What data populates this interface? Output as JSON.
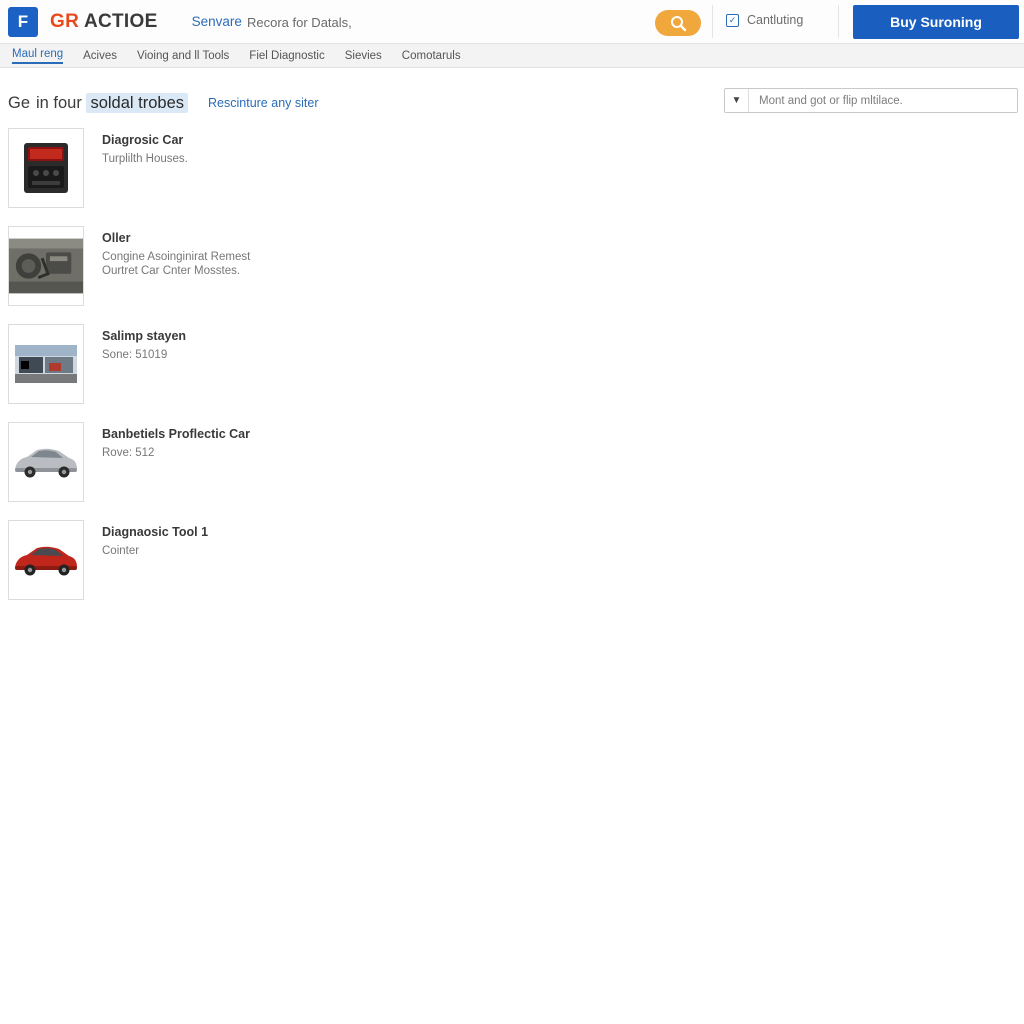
{
  "topbar": {
    "logo_letter": "F",
    "brand_text_1": "GR",
    "brand_text_2": "ACTIOE",
    "nav_primary": "Senvare",
    "search_value": "Recora for Datals,",
    "search_icon": "search-icon",
    "cart_label": "Cantluting",
    "cart_icon": "cart-checkbox-icon",
    "buy_button": "Buy Suroning"
  },
  "subnav": {
    "items": [
      {
        "label": "Maul reng",
        "active": true
      },
      {
        "label": "Acives",
        "active": false
      },
      {
        "label": "Vioing and ll Tools",
        "active": false
      },
      {
        "label": "Fiel Diagnostic",
        "active": false
      },
      {
        "label": "Sievies",
        "active": false
      },
      {
        "label": "Comotaruls",
        "active": false
      }
    ]
  },
  "results": {
    "title_prefix": "Ge",
    "title_mid": "in four",
    "title_highlight": "soldal trobes",
    "sub_link": "Rescinture any siter",
    "sort_placeholder": "Mont and got or flip mltilace.",
    "sort_caret_icon": "chevron-down-icon"
  },
  "items": [
    {
      "title": "Diagrosic Car",
      "desc": "Turplilth Houses.",
      "thumb": "obd-scanner-icon"
    },
    {
      "title": "Oller",
      "desc": "Congine Asoinginirat Remest\nOurtret Car Cnter Mosstes.",
      "thumb": "engine-bay-icon"
    },
    {
      "title": "Salimp stayen",
      "desc": "Sone: 51019",
      "thumb": "shop-front-icon"
    },
    {
      "title": "Banbetiels Proflectic Car",
      "desc": "Rove: 512",
      "thumb": "silver-sedan-icon"
    },
    {
      "title": "Diagnaosic Tool 1",
      "desc": "Cointer",
      "thumb": "red-coupe-icon"
    }
  ]
}
